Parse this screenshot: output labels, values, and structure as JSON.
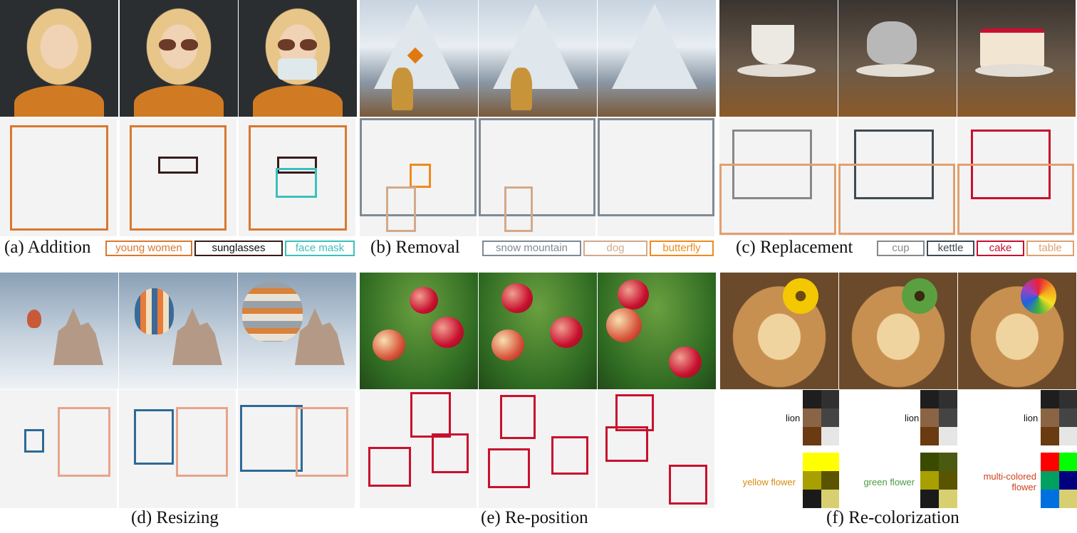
{
  "panels": {
    "a": {
      "caption": "(a) Addition",
      "tags": [
        "young women",
        "sunglasses",
        "face mask"
      ]
    },
    "b": {
      "caption": "(b) Removal",
      "tags": [
        "snow mountain",
        "dog",
        "butterfly"
      ]
    },
    "c": {
      "caption": "(c) Replacement",
      "tags": [
        "cup",
        "kettle",
        "cake",
        "table"
      ]
    },
    "d": {
      "caption": "(d) Resizing"
    },
    "e": {
      "caption": "(e) Re-position"
    },
    "f": {
      "caption": "(f) Re-colorization",
      "lion_label": "lion",
      "flower_labels": [
        "yellow flower",
        "green flower",
        "multi-colored flower"
      ]
    }
  },
  "colors": {
    "young_women": "#d9782f",
    "sunglasses": "#3a1a1a",
    "face_mask": "#3cc0bc",
    "snow_mountain": "#7f8a93",
    "dog": "#d2a98a",
    "butterfly": "#ef8a1e",
    "cup": "#888888",
    "kettle": "#3f4a52",
    "cake": "#c8102e",
    "table": "#e0a070",
    "balloon": "#2d6a96",
    "castle": "#e8a48a",
    "apple": "#c8102e"
  }
}
